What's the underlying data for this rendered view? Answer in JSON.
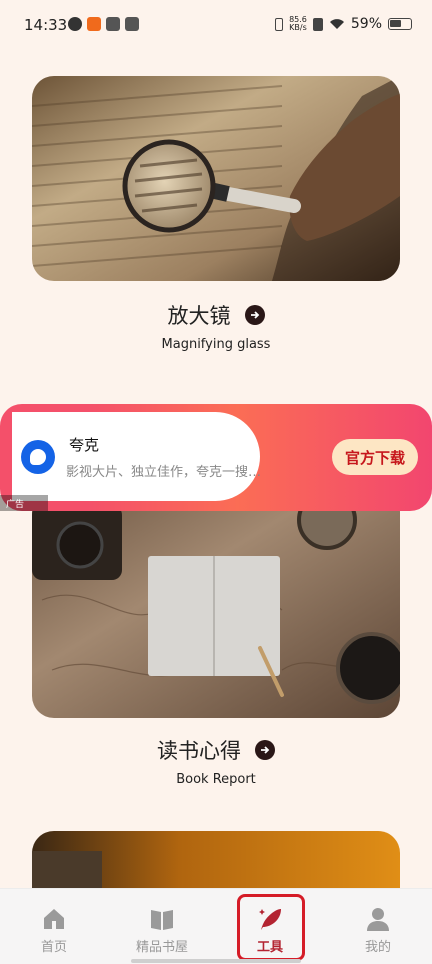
{
  "status_bar": {
    "time": "14:33",
    "net_speed_value": "85.6",
    "net_speed_unit": "KB/s",
    "battery": "59%"
  },
  "tools": [
    {
      "title": "放大镜",
      "subtitle": "Magnifying glass"
    },
    {
      "title": "读书心得",
      "subtitle": "Book Report"
    }
  ],
  "ad": {
    "app_name": "夸克",
    "description": "影视大片、独立佳作，夸克一搜…",
    "download_label": "官方下载",
    "tag": "广告"
  },
  "nav": {
    "items": [
      {
        "label": "首页",
        "icon": "home-icon"
      },
      {
        "label": "精品书屋",
        "icon": "book-icon"
      },
      {
        "label": "工具",
        "icon": "feather-icon"
      },
      {
        "label": "我的",
        "icon": "user-icon"
      }
    ],
    "active_index": 2
  },
  "colors": {
    "background": "#fdf3ec",
    "accent": "#b32331",
    "highlight_box": "#d51c27"
  }
}
